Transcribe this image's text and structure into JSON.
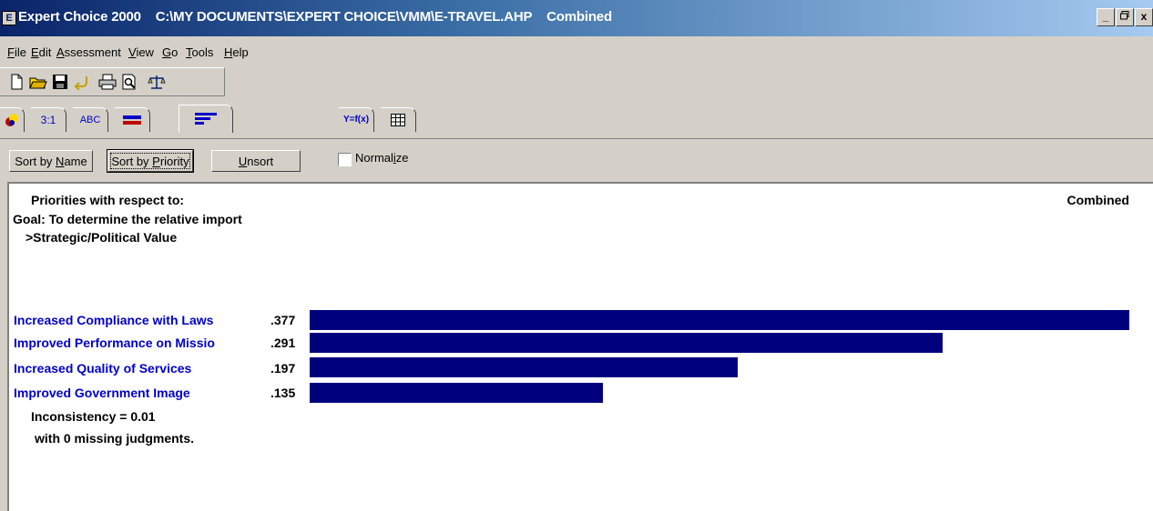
{
  "window": {
    "app_name": "Expert Choice 2000",
    "file_path": "C:\\MY DOCUMENTS\\EXPERT CHOICE\\VMM\\E-TRAVEL.AHP",
    "mode": "Combined",
    "controls": {
      "minimize": "_",
      "maximize": "ȅ",
      "close": "x"
    }
  },
  "menubar": {
    "items": [
      {
        "pre": "",
        "key": "F",
        "post": "ile"
      },
      {
        "pre": "",
        "key": "E",
        "post": "dit"
      },
      {
        "pre": "",
        "key": "A",
        "post": "ssessment"
      },
      {
        "pre": "",
        "key": "V",
        "post": "iew"
      },
      {
        "pre": "",
        "key": "G",
        "post": "o"
      },
      {
        "pre": "",
        "key": "T",
        "post": "ools"
      },
      {
        "pre": "",
        "key": "H",
        "post": "elp"
      }
    ]
  },
  "toolbar": {
    "icons": [
      "new-icon",
      "open-icon",
      "save-icon",
      "undo-icon",
      "print-icon",
      "print-preview-icon",
      "balance-scale-icon"
    ]
  },
  "tabs": {
    "items": [
      {
        "name": "model-tab",
        "label": ""
      },
      {
        "name": "pairwise-numeric-tab",
        "label": "3:1"
      },
      {
        "name": "verbal-tab",
        "label": "ABC"
      },
      {
        "name": "graphical-tab",
        "label": ""
      },
      {
        "name": "priorities-tab",
        "label": ""
      },
      {
        "name": "formula-tab",
        "label": "Y=f(x)"
      },
      {
        "name": "data-grid-tab",
        "label": ""
      }
    ]
  },
  "buttons": {
    "sort_by_name": {
      "pre": "Sort by ",
      "key": "N",
      "post": "ame"
    },
    "sort_by_priority": {
      "pre": "Sort by ",
      "key": "P",
      "post": "riority"
    },
    "unsort": {
      "pre": "",
      "key": "U",
      "post": "nsort"
    },
    "normalize": {
      "pre": "Normal",
      "key": "i",
      "post": "ze"
    }
  },
  "report": {
    "heading": "Priorities with respect to:",
    "combined": "Combined",
    "goal": "Goal: To determine the relative import",
    "node": ">Strategic/Political Value",
    "colors": {
      "label": "#0000c8",
      "bar": "#00007f"
    },
    "rows": [
      {
        "label": "Increased Compliance with Laws",
        "value": ".377"
      },
      {
        "label": "Improved Performance on Missio",
        "value": ".291"
      },
      {
        "label": "Increased Quality of Services",
        "value": ".197"
      },
      {
        "label": "Improved Government Image",
        "value": ".135"
      }
    ],
    "inconsistency": "Inconsistency = 0.01",
    "missing": "with 0  missing judgments."
  }
}
